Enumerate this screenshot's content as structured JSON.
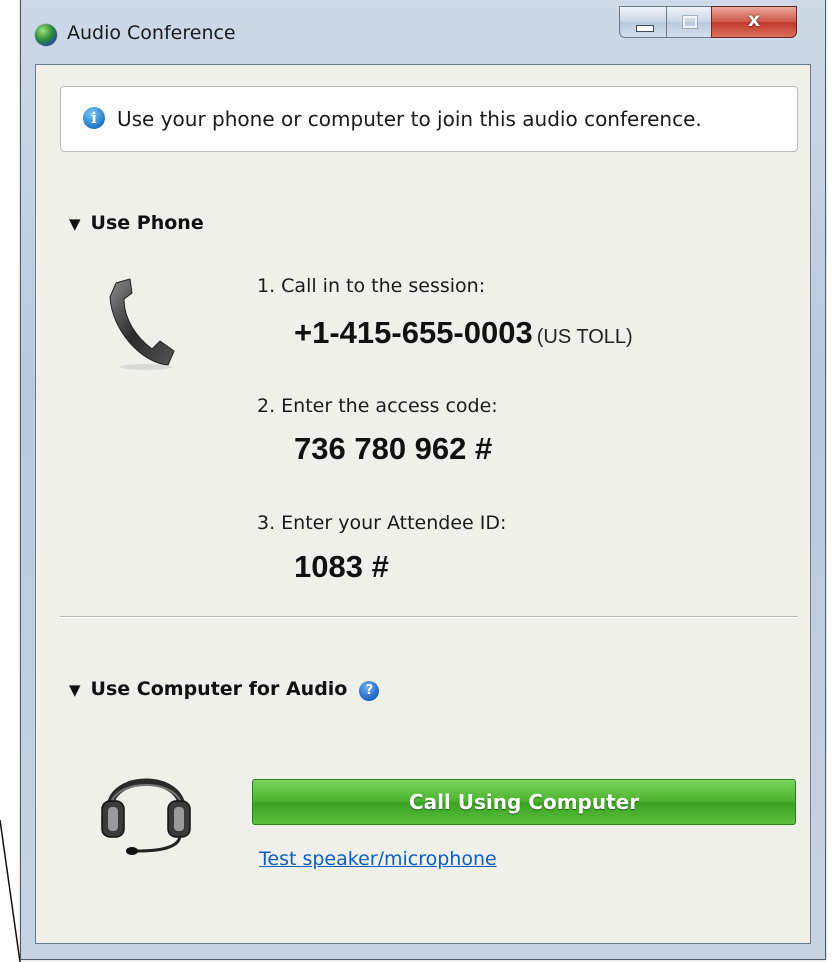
{
  "window": {
    "title": "Audio Conference",
    "close_glyph": "x"
  },
  "info": {
    "icon": "i",
    "text": "Use your phone or computer to join this audio conference."
  },
  "phone_section": {
    "toggle": "▼",
    "heading": "Use Phone",
    "steps": [
      {
        "label": "1. Call in to the session:",
        "value": "+1-415-655-0003",
        "note": "(US TOLL)"
      },
      {
        "label": "2. Enter the access code:",
        "value": "736 780 962 #"
      },
      {
        "label": "3. Enter your Attendee ID:",
        "value": "1083 #"
      }
    ]
  },
  "computer_section": {
    "toggle": "▼",
    "heading": "Use Computer for Audio",
    "help_icon": "?",
    "call_button": "Call Using Computer",
    "test_link": "Test speaker/microphone"
  },
  "colors": {
    "button_green": "#49b22c",
    "link_blue": "#0b5fc2",
    "info_blue": "#1f78c8"
  }
}
